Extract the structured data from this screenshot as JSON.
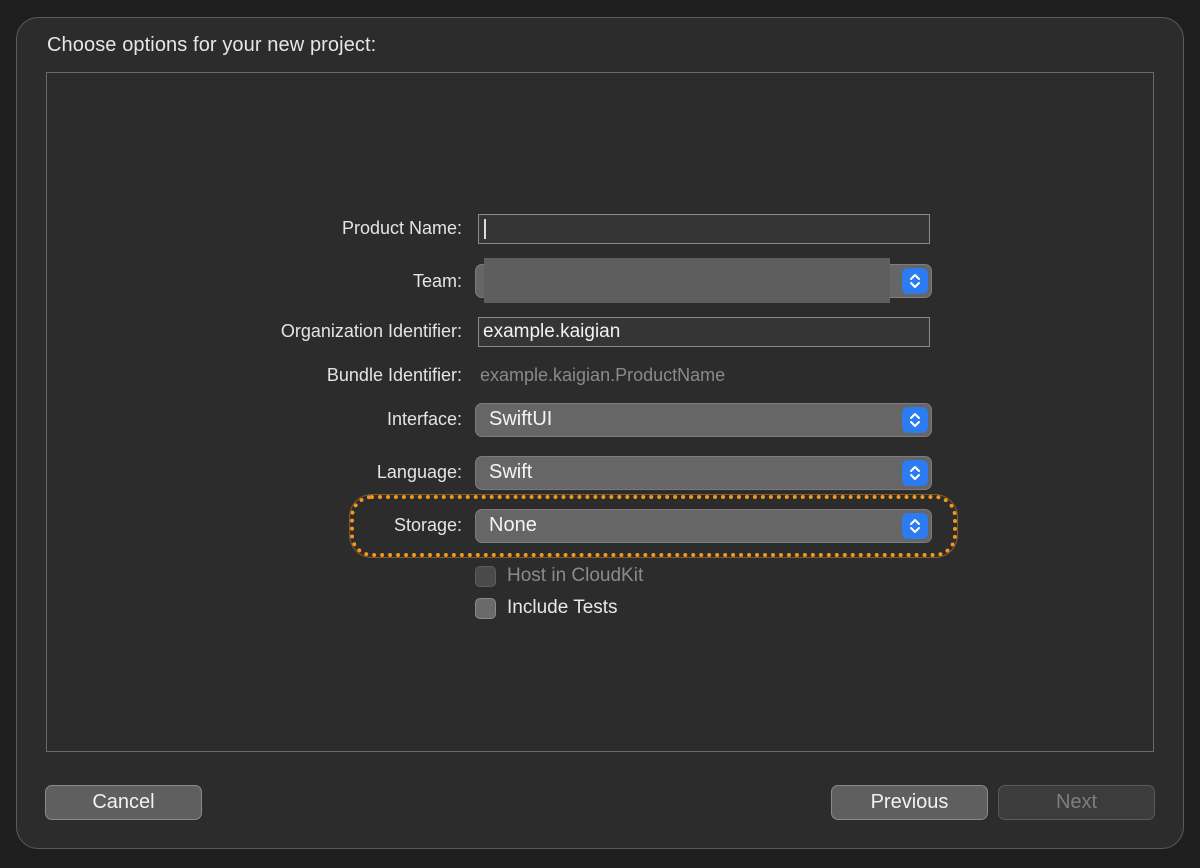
{
  "dialog": {
    "title": "Choose options for your new project:"
  },
  "form": {
    "product_name": {
      "label": "Product Name:",
      "value": ""
    },
    "team": {
      "label": "Team:",
      "value": ""
    },
    "organization_identifier": {
      "label": "Organization Identifier:",
      "value": "example.kaigian"
    },
    "bundle_identifier": {
      "label": "Bundle Identifier:",
      "value": "example.kaigian.ProductName"
    },
    "interface": {
      "label": "Interface:",
      "value": "SwiftUI"
    },
    "language": {
      "label": "Language:",
      "value": "Swift"
    },
    "storage": {
      "label": "Storage:",
      "value": "None"
    },
    "host_in_cloudkit": {
      "label": "Host in CloudKit",
      "checked": false,
      "enabled": false
    },
    "include_tests": {
      "label": "Include Tests",
      "checked": false,
      "enabled": true
    }
  },
  "buttons": {
    "cancel": "Cancel",
    "previous": "Previous",
    "next": "Next"
  },
  "colors": {
    "accent": "#2d7bf0",
    "highlight": "#f2961d"
  },
  "icons": {
    "popup_stepper": "chevron-up-down-icon"
  }
}
